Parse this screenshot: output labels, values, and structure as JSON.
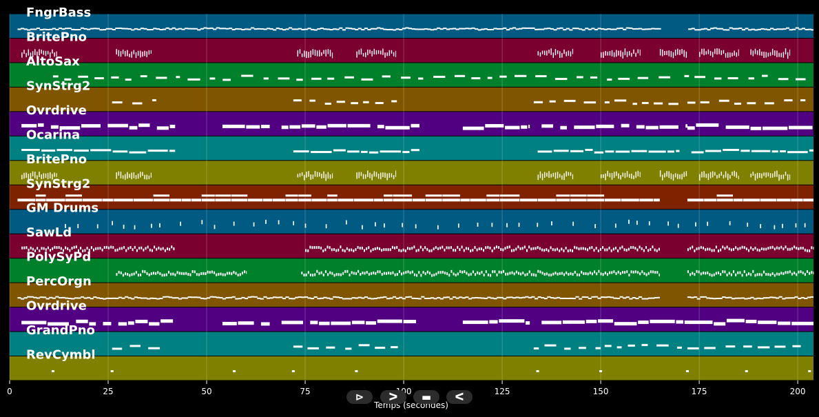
{
  "chart_data": {
    "type": "piano-roll",
    "xlabel": "Temps (secondes)",
    "xlim": [
      0,
      204
    ],
    "x_ticks": [
      0,
      25,
      50,
      75,
      100,
      125,
      150,
      175,
      200
    ],
    "grid": true,
    "tracks": [
      {
        "name": "FngrBass",
        "color": "#005a82",
        "style": "dense_thin",
        "segments": [
          [
            2,
            204
          ]
        ],
        "gaps": [
          [
            165,
            172
          ]
        ]
      },
      {
        "name": "BritePno",
        "color": "#7a0030",
        "style": "clusters",
        "segments": [
          [
            3,
            12
          ],
          [
            27,
            36
          ],
          [
            73,
            82
          ],
          [
            88,
            98
          ],
          [
            134,
            143
          ],
          [
            150,
            160
          ],
          [
            165,
            172
          ],
          [
            175,
            185
          ],
          [
            188,
            198
          ]
        ]
      },
      {
        "name": "AltoSax",
        "color": "#00802a",
        "style": "dashes",
        "segments": [
          [
            11,
            202
          ]
        ],
        "gaps": [
          [
            165,
            171
          ]
        ]
      },
      {
        "name": "SynStrg2",
        "color": "#7f5500",
        "style": "dashes",
        "segments": [
          [
            26,
            39
          ],
          [
            72,
            100
          ],
          [
            133,
            150
          ],
          [
            151,
            171
          ],
          [
            172,
            203
          ]
        ]
      },
      {
        "name": "Ovrdrive",
        "color": "#500080",
        "style": "thick",
        "segments": [
          [
            3,
            42
          ],
          [
            54,
            66
          ],
          [
            69,
            104
          ],
          [
            115,
            132
          ],
          [
            135,
            172
          ],
          [
            172,
            204
          ]
        ]
      },
      {
        "name": "Ocarina",
        "color": "#008080",
        "style": "thick_thin",
        "segments": [
          [
            3,
            42
          ],
          [
            72,
            104
          ],
          [
            134,
            170
          ],
          [
            173,
            204
          ]
        ]
      },
      {
        "name": "BritePno",
        "color": "#808000",
        "style": "clusters",
        "segments": [
          [
            3,
            12
          ],
          [
            27,
            36
          ],
          [
            73,
            82
          ],
          [
            88,
            98
          ],
          [
            134,
            143
          ],
          [
            150,
            160
          ],
          [
            165,
            172
          ],
          [
            175,
            185
          ],
          [
            188,
            198
          ]
        ]
      },
      {
        "name": "SynStrg2",
        "color": "#7f2200",
        "style": "long_bar",
        "segments": [
          [
            2,
            165
          ],
          [
            172,
            204
          ]
        ]
      },
      {
        "name": "GM Drums",
        "color": "#005a82",
        "style": "ticks",
        "segments": [
          [
            14,
            204
          ]
        ]
      },
      {
        "name": "SawLd",
        "color": "#7a0030",
        "style": "dense_small",
        "segments": [
          [
            3,
            42
          ],
          [
            75,
            165
          ],
          [
            172,
            204
          ]
        ]
      },
      {
        "name": "PolySyPd",
        "color": "#00802a",
        "style": "dense_small",
        "segments": [
          [
            27,
            60
          ],
          [
            74,
            165
          ],
          [
            172,
            204
          ]
        ]
      },
      {
        "name": "PercOrgn",
        "color": "#7f5500",
        "style": "dense_thin",
        "segments": [
          [
            2,
            165
          ],
          [
            172,
            204
          ]
        ]
      },
      {
        "name": "Ovrdrive",
        "color": "#500080",
        "style": "thick",
        "segments": [
          [
            3,
            42
          ],
          [
            54,
            66
          ],
          [
            69,
            104
          ],
          [
            115,
            132
          ],
          [
            135,
            172
          ],
          [
            172,
            204
          ]
        ]
      },
      {
        "name": "GrandPno",
        "color": "#008080",
        "style": "dashes",
        "segments": [
          [
            26,
            39
          ],
          [
            72,
            100
          ],
          [
            133,
            150
          ],
          [
            151,
            171
          ],
          [
            172,
            203
          ]
        ]
      },
      {
        "name": "RevCymbl",
        "color": "#808000",
        "style": "sparse",
        "points": [
          11,
          26,
          57,
          72,
          88,
          134,
          150,
          172,
          187,
          203
        ]
      }
    ]
  },
  "controls": [
    {
      "id": "play",
      "glyph": "⊳",
      "name": "play-icon"
    },
    {
      "id": "forward",
      "glyph": "ᐳ",
      "name": "forward-icon"
    },
    {
      "id": "stop",
      "glyph": "▬",
      "name": "stop-icon"
    },
    {
      "id": "back",
      "glyph": "ᐸ",
      "name": "back-icon"
    }
  ]
}
